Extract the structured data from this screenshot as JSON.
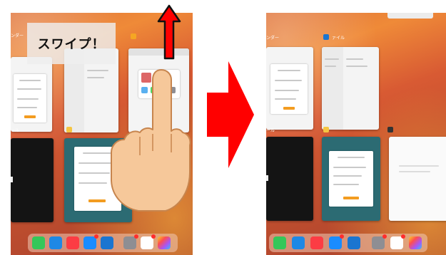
{
  "instruction": {
    "label": "スワイプ！"
  },
  "colors": {
    "arrow_red": "#ff0000",
    "arrow_outline": "#111111",
    "wallpaper_orange": "#e0743a",
    "dialog_button_orange": "#f39c20",
    "skin": "#f6c89a"
  },
  "icons": {
    "up_arrow": "up-arrow-icon",
    "right_arrow": "right-arrow-icon",
    "hand": "pointing-hand-icon"
  },
  "dock_apps": [
    "messages",
    "safari",
    "music",
    "mail",
    "files",
    "settings",
    "gmail",
    "photos"
  ]
}
